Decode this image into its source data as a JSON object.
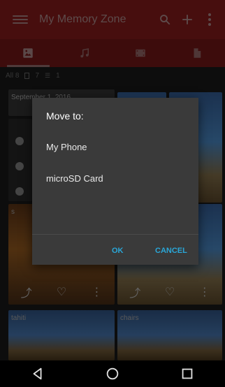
{
  "app_bar": {
    "title": "My Memory Zone",
    "icons": [
      "menu-icon",
      "search-icon",
      "add-icon",
      "overflow-icon"
    ]
  },
  "tabs": [
    {
      "name": "photos",
      "icon": "image-icon",
      "active": true
    },
    {
      "name": "music",
      "icon": "music-icon",
      "active": false
    },
    {
      "name": "videos",
      "icon": "film-icon",
      "active": false
    },
    {
      "name": "documents",
      "icon": "document-icon",
      "active": false
    }
  ],
  "counts": {
    "all": "All 8",
    "folders": "7",
    "items": "1"
  },
  "cards": {
    "top_left_label": "September 1, 2016",
    "mid_left_label": "s",
    "bottom_left_label": "tahiti",
    "bottom_right_label": "chairs"
  },
  "dialog": {
    "title": "Move to:",
    "options": [
      "My Phone",
      "microSD Card"
    ],
    "ok_label": "OK",
    "cancel_label": "CANCEL"
  },
  "colors": {
    "app_bar_dimmed": "#6e1616",
    "dialog_bg": "#3a3a3a",
    "button_accent": "#2aa7d8"
  }
}
